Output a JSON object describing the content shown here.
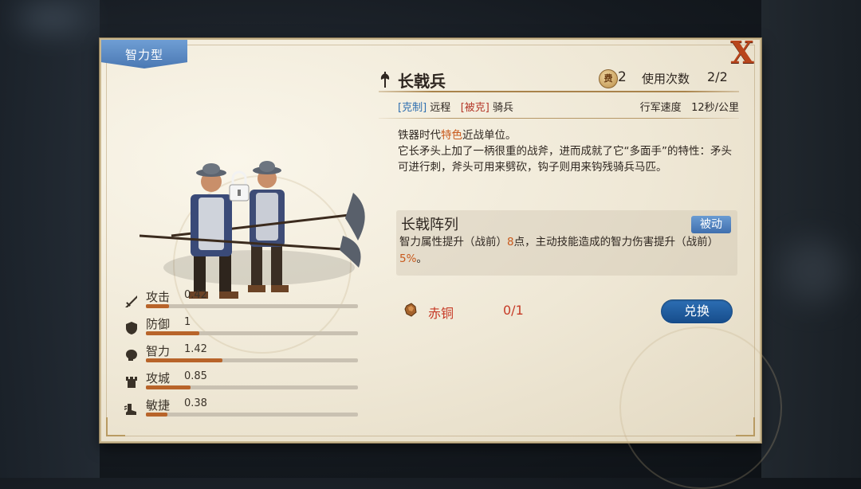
{
  "panel": {
    "type_tag": "智力型",
    "close_label": "X"
  },
  "unit": {
    "name": "长戟兵",
    "cost_badge": "费",
    "cost": "2",
    "uses_label": "使用次数",
    "uses_value": "2/2",
    "counters_label": "[克制]",
    "counters_value": "远程",
    "countered_label": "[被克]",
    "countered_value": "骑兵",
    "march_label": "行军速度",
    "march_value": "12秒/公里",
    "description": {
      "p1_pre": "铁器时代",
      "p1_hl": "特色",
      "p1_post": "近战单位。",
      "p2": "它长矛头上加了一柄很重的战斧，进而成就了它“多面手”的特性：矛头可进行刺，斧头可用来劈砍，钩子则用来钩残骑兵马匹。"
    }
  },
  "skill": {
    "name": "长戟阵列",
    "type": "被动",
    "desc_a": "智力属性提升（战前）",
    "desc_hl1": "8",
    "desc_b": "点，主动技能造成的智力伤害提升（战前）",
    "desc_hl2": "5%",
    "desc_c": "。"
  },
  "resource": {
    "name": "赤铜",
    "count": "0/1",
    "exchange_label": "兑换"
  },
  "stats": [
    {
      "label": "攻击",
      "value": "0.42",
      "fill": 0.11,
      "icon": "sword-icon"
    },
    {
      "label": "防御",
      "value": "1",
      "fill": 0.25,
      "icon": "shield-icon"
    },
    {
      "label": "智力",
      "value": "1.42",
      "fill": 0.36,
      "icon": "brain-icon"
    },
    {
      "label": "攻城",
      "value": "0.85",
      "fill": 0.21,
      "icon": "tower-icon"
    },
    {
      "label": "敏捷",
      "value": "0.38",
      "fill": 0.1,
      "icon": "boot-icon"
    }
  ],
  "colors": {
    "accent_orange": "#c8591c",
    "stat_fill": "#b8642a",
    "tag_blue": "#4a78b3",
    "button_blue": "#164c8a",
    "resource_red": "#c63a26"
  }
}
